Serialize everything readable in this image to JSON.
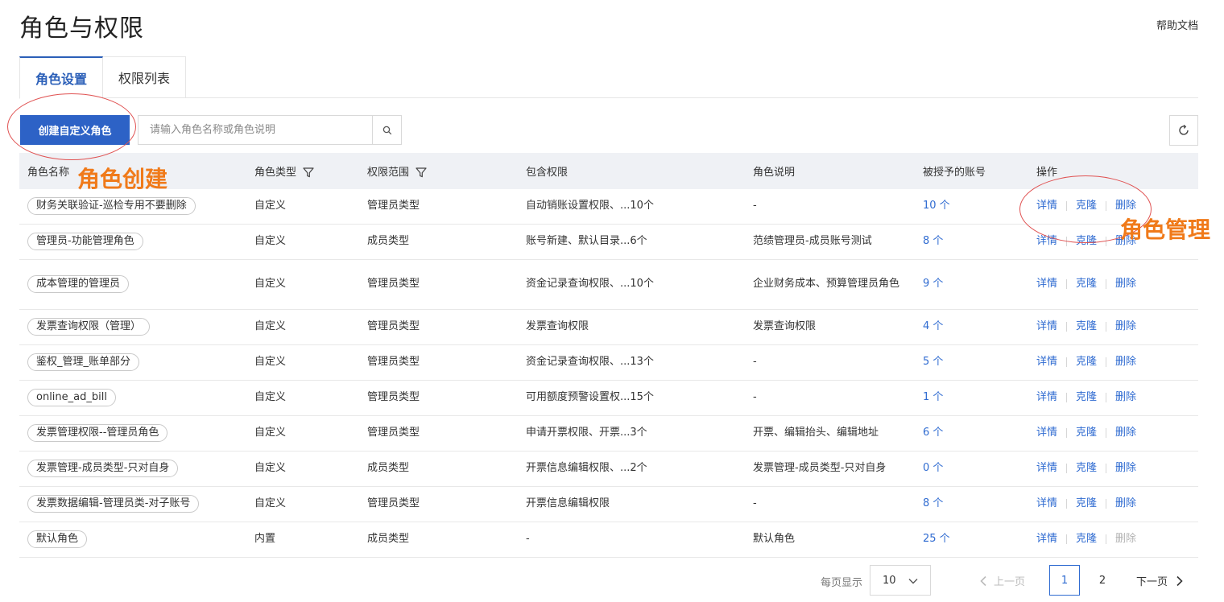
{
  "page": {
    "title": "角色与权限",
    "help": "帮助文档"
  },
  "tabs": [
    {
      "label": "角色设置"
    },
    {
      "label": "权限列表"
    }
  ],
  "toolbar": {
    "create_label": "创建自定义角色",
    "search_placeholder": "请输入角色名称或角色说明"
  },
  "table": {
    "headers": {
      "name": "角色名称",
      "type": "角色类型",
      "scope": "权限范围",
      "perms": "包含权限",
      "desc": "角色说明",
      "accounts": "被授予的账号",
      "ops": "操作"
    },
    "op_labels": {
      "detail": "详情",
      "clone": "克隆",
      "delete": "删除"
    },
    "rows": [
      {
        "name": "财务关联验证-巡检专用不要删除",
        "type": "自定义",
        "scope": "管理员类型",
        "perms": "自动销账设置权限、...10个",
        "desc": "-",
        "accounts": "10 个"
      },
      {
        "name": "管理员-功能管理角色",
        "type": "自定义",
        "scope": "成员类型",
        "perms": "账号新建、默认目录...6个",
        "desc": "范绩管理员-成员账号测试",
        "accounts": "8 个"
      },
      {
        "name": "成本管理的管理员",
        "type": "自定义",
        "scope": "管理员类型",
        "perms": "资金记录查询权限、...10个",
        "desc": "企业财务成本、预算管理员角色",
        "accounts": "9 个"
      },
      {
        "name": "发票查询权限（管理）",
        "type": "自定义",
        "scope": "管理员类型",
        "perms": "发票查询权限",
        "desc": "发票查询权限",
        "accounts": "4 个"
      },
      {
        "name": "鉴权_管理_账单部分",
        "type": "自定义",
        "scope": "管理员类型",
        "perms": "资金记录查询权限、...13个",
        "desc": "-",
        "accounts": "5 个"
      },
      {
        "name": "online_ad_bill",
        "type": "自定义",
        "scope": "管理员类型",
        "perms": "可用额度预警设置权...15个",
        "desc": "-",
        "accounts": "1 个"
      },
      {
        "name": "发票管理权限--管理员角色",
        "type": "自定义",
        "scope": "管理员类型",
        "perms": "申请开票权限、开票...3个",
        "desc": "开票、编辑抬头、编辑地址",
        "accounts": "6 个"
      },
      {
        "name": "发票管理-成员类型-只对自身",
        "type": "自定义",
        "scope": "成员类型",
        "perms": "开票信息编辑权限、...2个",
        "desc": "发票管理-成员类型-只对自身",
        "accounts": "0 个"
      },
      {
        "name": "发票数据编辑-管理员类-对子账号",
        "type": "自定义",
        "scope": "管理员类型",
        "perms": "开票信息编辑权限",
        "desc": "-",
        "accounts": "8 个"
      },
      {
        "name": "默认角色",
        "type": "内置",
        "scope": "成员类型",
        "perms": "-",
        "desc": "默认角色",
        "accounts": "25 个"
      }
    ]
  },
  "annotations": {
    "create": "角色创建",
    "manage": "角色管理"
  },
  "pagination": {
    "per_page_label": "每页显示",
    "page_size": "10",
    "prev": "上一页",
    "next": "下一页",
    "pages": [
      "1",
      "2"
    ]
  },
  "colors": {
    "primary": "#2d62c6",
    "link": "#2f6bd1",
    "annotation": "#f07a1a",
    "annotation_ring": "#e05252"
  }
}
